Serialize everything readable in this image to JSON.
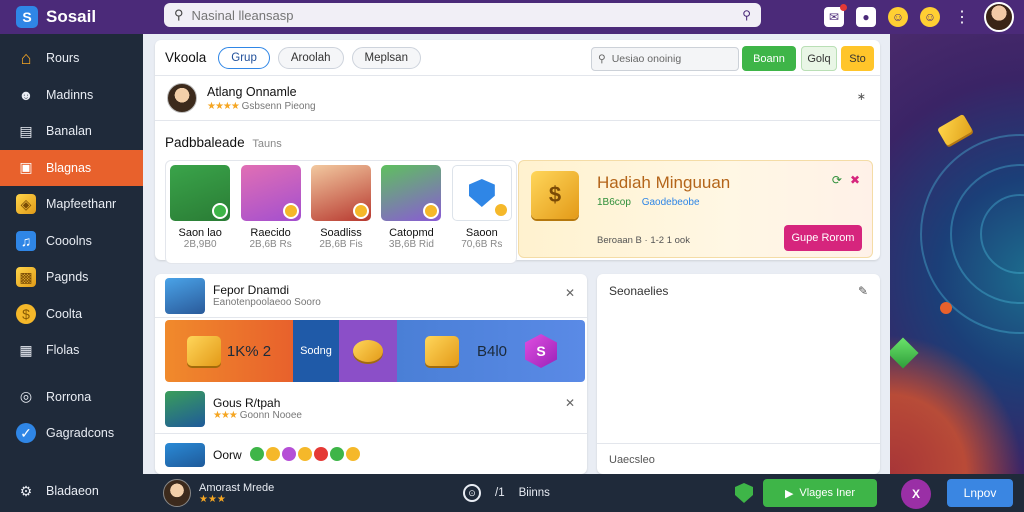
{
  "app": {
    "name": "Sosail",
    "logo_glyph": "S"
  },
  "search": {
    "placeholder": "Nasinal lleansasp"
  },
  "sidebar": {
    "items": [
      {
        "label": "Rours",
        "icon": "home-icon"
      },
      {
        "label": "Madinns",
        "icon": "user-icon"
      },
      {
        "label": "Banalan",
        "icon": "chart-icon"
      },
      {
        "label": "Blagnas",
        "icon": "square-icon",
        "active": true
      },
      {
        "label": "Mapfeethanr",
        "icon": "chest-icon"
      },
      {
        "label": "Cooolns",
        "icon": "note-icon"
      },
      {
        "label": "Pagnds",
        "icon": "box-icon"
      },
      {
        "label": "Coolta",
        "icon": "coin-icon"
      },
      {
        "label": "Flolas",
        "icon": "building-icon"
      },
      {
        "label": "Rorrona",
        "icon": "globe-icon"
      },
      {
        "label": "Gagradcons",
        "icon": "shield-icon"
      }
    ],
    "footer": {
      "label": "Bladaeon",
      "icon": "settings-icon"
    }
  },
  "header": {
    "title": "Vkoola",
    "tabs": [
      "Grup",
      "Aroolah",
      "Meplsan"
    ],
    "mini_search_placeholder": "Uesiao onoinig",
    "btn_primary": "Boann",
    "btn_secondary": "Golq",
    "btn_yellow": "Sto"
  },
  "user": {
    "name": "Atlang Onnamle",
    "stars": "★★★★",
    "meta": "Gsbsenn Pieong"
  },
  "featured": {
    "title": "Padbbaleade",
    "subtitle": "Tauns",
    "games": [
      {
        "name": "Saon lao",
        "count": "2B,9B0"
      },
      {
        "name": "Raecido",
        "count": "2B,6B Rs"
      },
      {
        "name": "Soadliss",
        "count": "2B,6B Fis"
      },
      {
        "name": "Catopmd",
        "count": "3B,6B Rid"
      },
      {
        "name": "Saoon",
        "count": "70,6B Rs"
      }
    ]
  },
  "promo": {
    "title": "Hadiah Minguuan",
    "reward": "1B6cop",
    "link": "Gaodebeobe",
    "info": "Beroaan B · 1-2 1 ook",
    "button": "Gupe Rorom"
  },
  "feed": {
    "first": {
      "name": "Fepor Dnamdi",
      "meta": "Eanotenpoolaeoo Sooro"
    },
    "banner": {
      "left_value": "1K% 2",
      "mid_label": "Sodng",
      "right_value": "B4l0"
    },
    "second": {
      "name": "Gous R/tpah",
      "stars": "★★★",
      "meta": "Goonn Nooee"
    },
    "third": {
      "name": "Oorw"
    }
  },
  "side_panel": {
    "title": "Seonaelies",
    "footer": "Uaecsleo"
  },
  "bottom": {
    "user_name": "Amorast Mrede",
    "user_stars": "★★★",
    "mid_label": "Biinns",
    "mid_counter": "/1",
    "btn_green": "Vlages Iner",
    "btn_blue": "Lnpov",
    "round_glyph": "X"
  }
}
